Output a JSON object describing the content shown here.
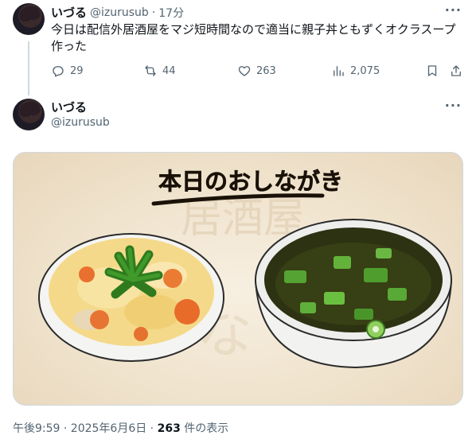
{
  "tweet1": {
    "display_name": "いづる",
    "handle": "@izurusub",
    "separator": "·",
    "time": "17分",
    "text": "今日は配信外居酒屋をマジ短時間なので適当に親子丼ともずくオクラスープ作った",
    "actions": {
      "reply_count": "29",
      "retweet_count": "44",
      "like_count": "263",
      "view_count": "2,075"
    }
  },
  "tweet2": {
    "display_name": "いづる",
    "handle": "@izurusub",
    "image": {
      "sign_text": "本日のおしながき",
      "watermark_text": "居酒屋"
    },
    "footer": {
      "timestamp": "午後9:59 · 2025年6月6日 · ",
      "views": "263",
      "views_suffix": " 件の表示"
    }
  },
  "colors": {
    "text_primary": "#0f1419",
    "text_secondary": "#536471",
    "border": "#cfd9de"
  },
  "icons": [
    "more-icon",
    "reply-icon",
    "retweet-icon",
    "like-icon",
    "views-icon",
    "bookmark-icon",
    "share-icon"
  ]
}
